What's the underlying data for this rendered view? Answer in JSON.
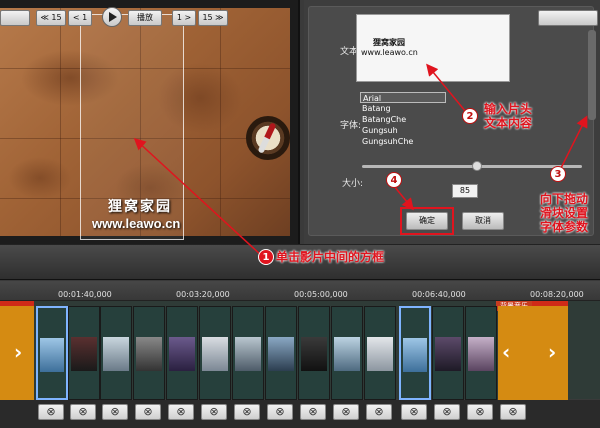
{
  "preview": {
    "watermark_zh": "狸窝家园",
    "watermark_url": "www.leawo.cn"
  },
  "text_panel": {
    "text_label": "文本:",
    "text_line1": "狸窝家园",
    "text_line2": "www.leawo.cn",
    "font_label": "字体:",
    "fonts": [
      "Arial",
      "Batang",
      "BatangChe",
      "Gungsuh",
      "GungsuhChe"
    ],
    "selected_font": "Arial",
    "size_label": "大小:",
    "size_value": "85",
    "size_slider_level": 0.5,
    "ok_label": "确定",
    "cancel_label": "取消"
  },
  "annotations": {
    "n1": "1",
    "n1_text": "单击影片中间的方框",
    "n2": "2",
    "n2_text_line1": "输入片头",
    "n2_text_line2": "文本内容",
    "n3": "3",
    "n3_text_line1": "向下拖动",
    "n3_text_line2": "滑块设置",
    "n3_text_line3": "字体参数",
    "n4": "4"
  },
  "controls": {
    "rewind": "≪ 15",
    "step_back": "< 1",
    "play_label": "播放",
    "step_fwd": "1 >",
    "forward": "15 ≫"
  },
  "timeline": {
    "ticks": [
      "00:01:40,000",
      "00:03:20,000",
      "00:05:00,000",
      "00:06:40,000",
      "00:08:20,000"
    ],
    "music_label": "背景音乐",
    "delete_symbol": "⊗"
  },
  "colors": {
    "annotation_red": "#e0141e",
    "track_orange": "#d58b12",
    "selection_blue": "#7fb4ff"
  }
}
